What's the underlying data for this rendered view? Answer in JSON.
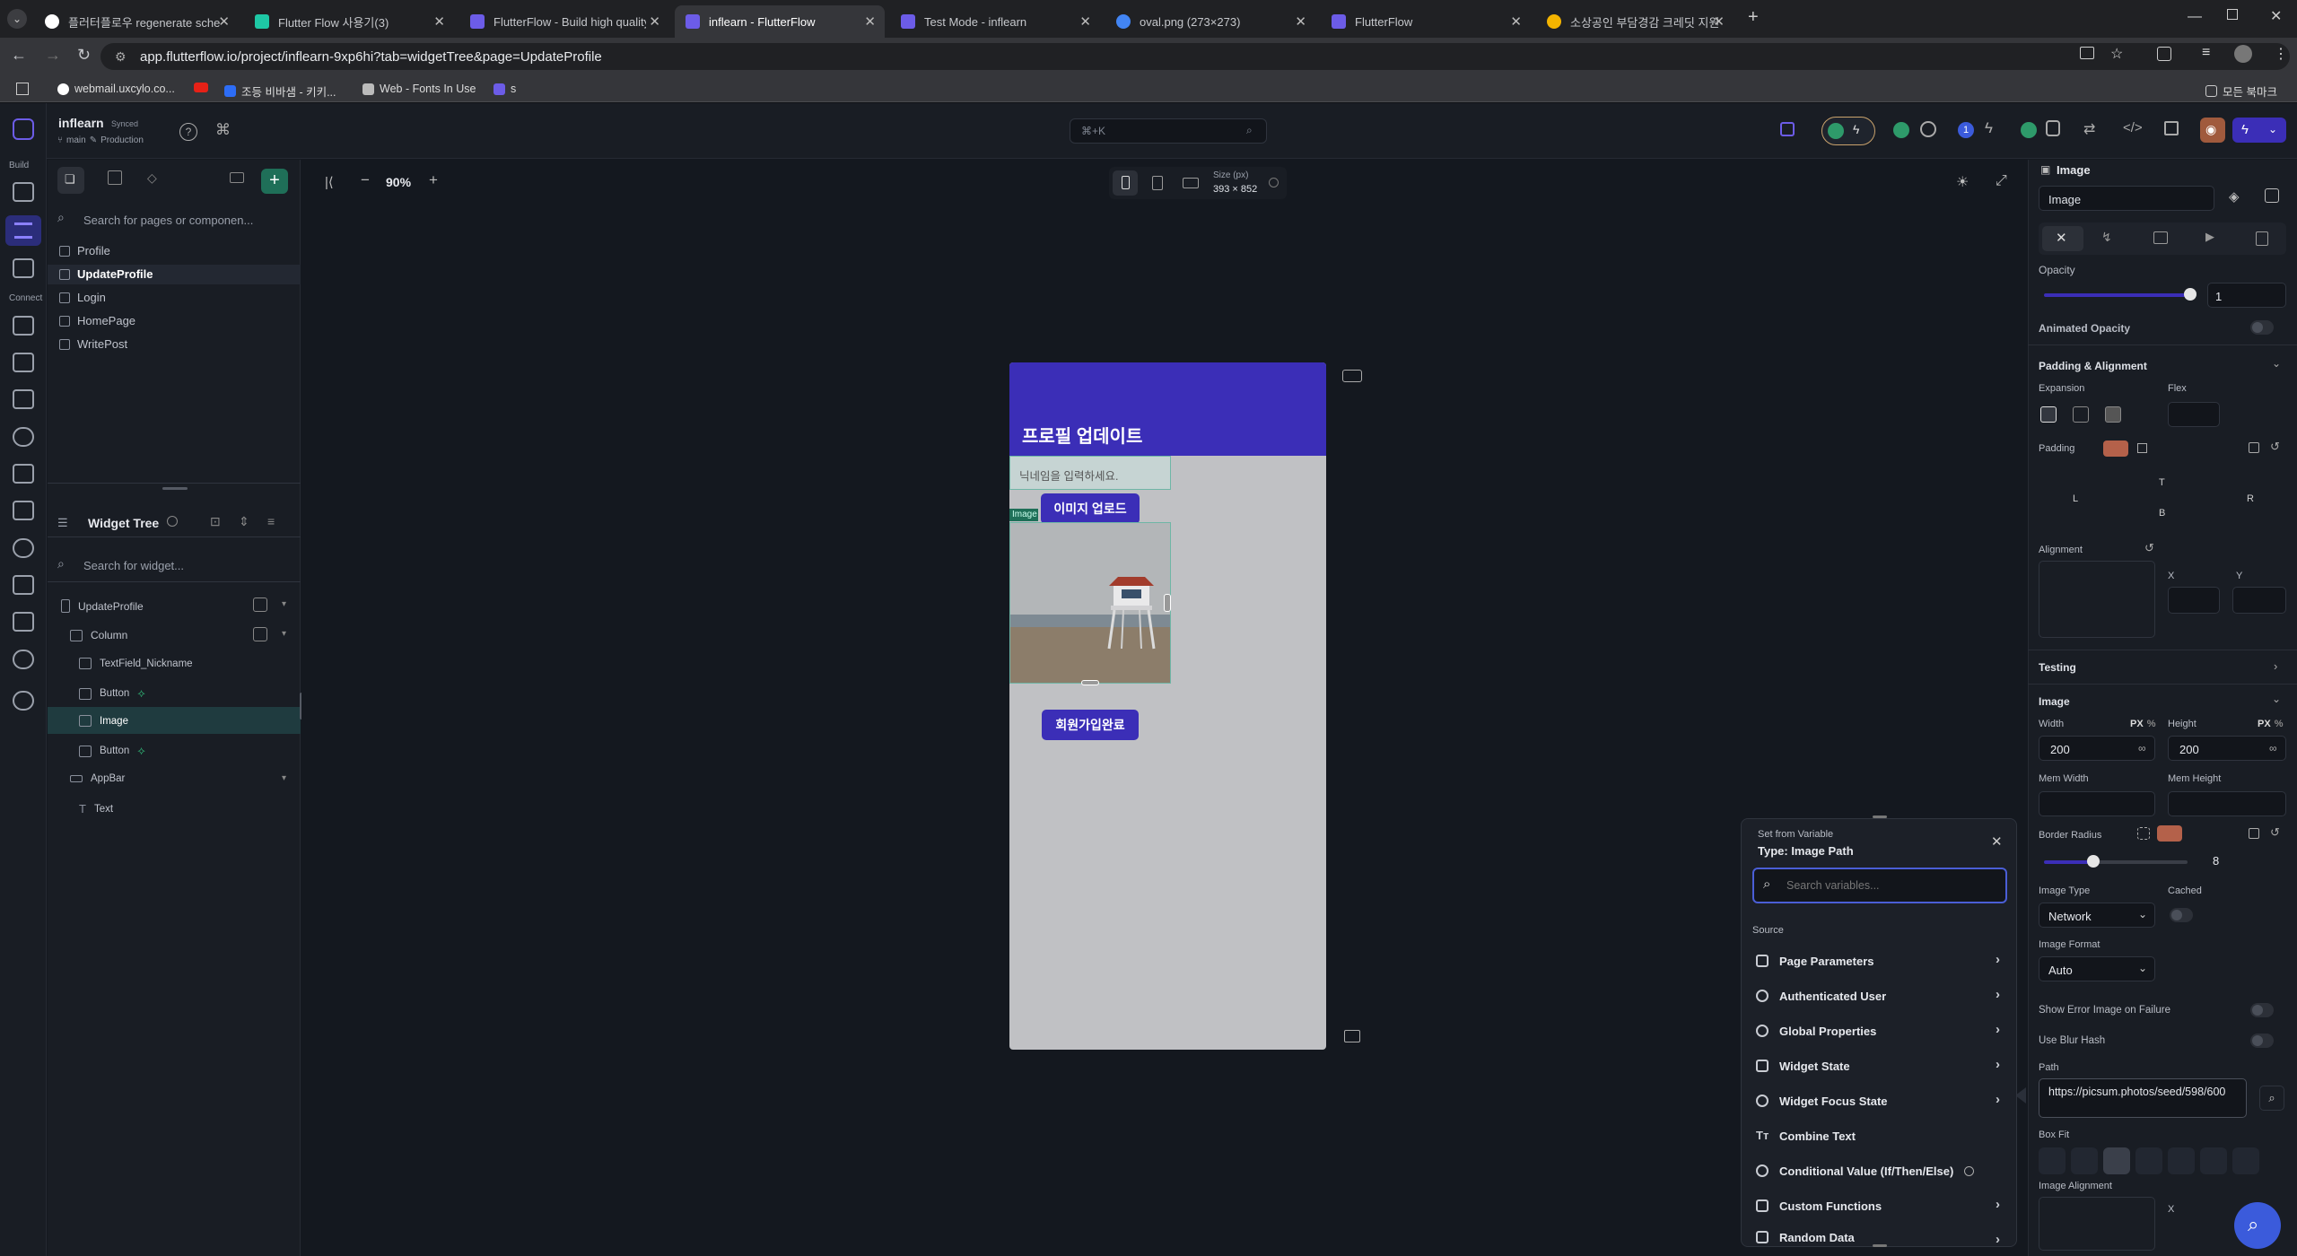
{
  "browser": {
    "tabs": [
      {
        "title": "플러터플로우 regenerate sche",
        "color": "#ffffff"
      },
      {
        "title": "Flutter Flow 사용기(3)",
        "color": "#1ec8a5"
      },
      {
        "title": "FlutterFlow - Build high quality",
        "color": "#6c5ce7"
      },
      {
        "title": "inflearn - FlutterFlow",
        "color": "#6c5ce7"
      },
      {
        "title": "Test Mode - inflearn",
        "color": "#6c5ce7"
      },
      {
        "title": "oval.png (273×273)",
        "color": "#4285f4"
      },
      {
        "title": "FlutterFlow",
        "color": "#6c5ce7"
      },
      {
        "title": "소상공인 부담경감 크레딧 지원",
        "color": "#f4b400"
      }
    ],
    "url": "app.flutterflow.io/project/inflearn-9xp6hi?tab=widgetTree&page=UpdateProfile",
    "bookmarks": [
      "webmail.uxcylo.co...",
      "",
      "조등 비바샘 - 키키...",
      "Web - Fonts In Use",
      "s"
    ],
    "all_bookmarks": "모든 북마크"
  },
  "project": {
    "name": "inflearn",
    "status": "Synced",
    "branch": "main",
    "env": "Production",
    "search_placeholder": "⌘+K",
    "notif_count": "1"
  },
  "rail": {
    "build_label": "Build",
    "connect_label": "Connect"
  },
  "pages": {
    "search_placeholder": "Search for pages or componen...",
    "items": [
      "Profile",
      "UpdateProfile",
      "Login",
      "HomePage",
      "WritePost"
    ]
  },
  "widget_tree": {
    "title": "Widget Tree",
    "search_placeholder": "Search for widget...",
    "items": [
      "UpdateProfile",
      "Column",
      "TextField_Nickname",
      "Button",
      "Image",
      "Button",
      "AppBar",
      "Text"
    ]
  },
  "canvas": {
    "zoom": "90%",
    "size_label": "Size (px)",
    "size_value": "393 × 852",
    "phone": {
      "title": "프로필 업데이트",
      "textfield_hint": "닉네임을 입력하세요.",
      "upload_button": "이미지 업로드",
      "image_tag": "Image",
      "signup_button": "회원가입완료"
    }
  },
  "properties": {
    "widget_type": "Image",
    "widget_name": "Image",
    "opacity_label": "Opacity",
    "opacity_value": "1",
    "animated_opacity": "Animated Opacity",
    "padding_alignment": "Padding & Alignment",
    "expansion": "Expansion",
    "flex": "Flex",
    "padding": "Padding",
    "pad_t": "T",
    "pad_l": "L",
    "pad_r": "R",
    "pad_b": "B",
    "alignment": "Alignment",
    "x": "X",
    "y": "Y",
    "testing": "Testing",
    "image_section": "Image",
    "width_label": "Width",
    "height_label": "Height",
    "px": "PX",
    "pct": "%",
    "width_value": "200",
    "height_value": "200",
    "mem_width": "Mem Width",
    "mem_height": "Mem Height",
    "border_radius": "Border Radius",
    "border_radius_value": "8",
    "image_type": "Image Type",
    "image_type_value": "Network",
    "cached": "Cached",
    "image_format": "Image Format",
    "image_format_value": "Auto",
    "show_error": "Show Error Image on Failure",
    "use_blur": "Use Blur Hash",
    "path_label": "Path",
    "path_value": "https://picsum.photos/seed/598/600",
    "box_fit": "Box Fit",
    "image_alignment": "Image Alignment"
  },
  "popup": {
    "heading": "Set from Variable",
    "type": "Type: Image Path",
    "search_placeholder": "Search variables...",
    "source_label": "Source",
    "sources": [
      "Page Parameters",
      "Authenticated User",
      "Global Properties",
      "Widget State",
      "Widget Focus State",
      "Combine Text",
      "Conditional Value (If/Then/Else)",
      "Custom Functions",
      "Random Data"
    ]
  },
  "colors": {
    "accent": "#3b2eb7",
    "brand": "#6c5ce7",
    "selected": "#1f3b3f"
  }
}
